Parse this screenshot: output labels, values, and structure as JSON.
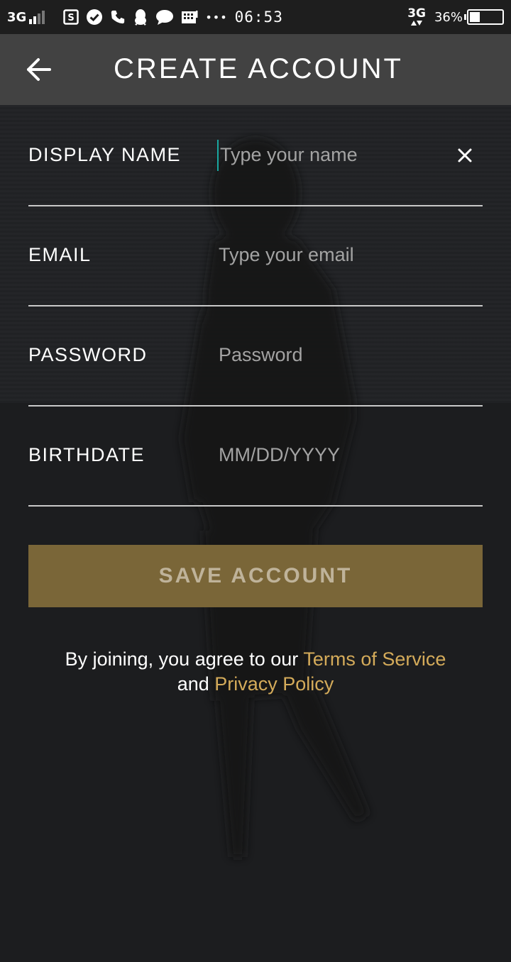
{
  "status_bar": {
    "network": "3G",
    "network_right": "3G",
    "time": "06:53",
    "battery_percent": "36%",
    "battery_level": 0.36,
    "more_dots": "•••"
  },
  "app_bar": {
    "title": "CREATE ACCOUNT"
  },
  "form": {
    "display_name": {
      "label": "DISPLAY NAME",
      "placeholder": "Type your name",
      "value": ""
    },
    "email": {
      "label": "EMAIL",
      "placeholder": "Type your email",
      "value": ""
    },
    "password": {
      "label": "PASSWORD",
      "placeholder": "Password",
      "value": ""
    },
    "birthdate": {
      "label": "BIRTHDATE",
      "placeholder": "MM/DD/YYYY",
      "value": ""
    }
  },
  "save_button": {
    "label": "SAVE ACCOUNT"
  },
  "terms": {
    "prefix": "By joining, you agree to our ",
    "terms_link": "Terms of Service",
    "middle": "and ",
    "privacy_link": "Privacy Policy"
  },
  "colors": {
    "accent_gold": "#d4ab5a",
    "button_bg": "#7a6638",
    "cursor_teal": "#19a7a0",
    "app_bar_bg": "#424242"
  }
}
